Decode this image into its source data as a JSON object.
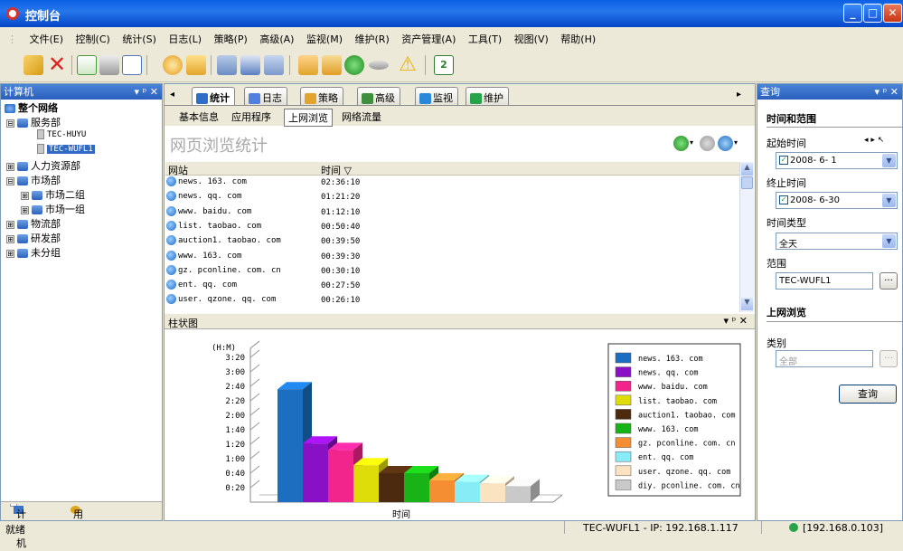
{
  "window": {
    "title": "控制台"
  },
  "menu": [
    "文件(E)",
    "控制(C)",
    "统计(S)",
    "日志(L)",
    "策略(P)",
    "高级(A)",
    "监视(M)",
    "维护(R)",
    "资产管理(A)",
    "工具(T)",
    "视图(V)",
    "帮助(H)"
  ],
  "toolbar_icons": [
    "new-icon",
    "delete-icon",
    "import-icon",
    "print-icon",
    "preview-icon",
    "globe-icon",
    "folder-icon",
    "copy-icon",
    "window-icon",
    "screen-icon",
    "monitor-icon",
    "chart-icon",
    "gem-icon",
    "chip-icon",
    "warning-icon",
    "refresh-icon"
  ],
  "left_panel": {
    "title": "计算机",
    "root": "整个网络",
    "tree": [
      {
        "label": "服务部",
        "expand": "⊟"
      },
      {
        "label": "TEC-HUYU",
        "indent": 2
      },
      {
        "label": "TEC-WUFL1",
        "indent": 2,
        "selected": true
      },
      {
        "label": "人力资源部",
        "expand": "⊞"
      },
      {
        "label": "市场部",
        "expand": "⊟"
      },
      {
        "label": "市场二组",
        "expand": "⊞",
        "indent": 1
      },
      {
        "label": "市场一组",
        "expand": "⊞",
        "indent": 1
      },
      {
        "label": "物流部",
        "expand": "⊞"
      },
      {
        "label": "研发部",
        "expand": "⊞"
      },
      {
        "label": "未分组",
        "expand": "⊞"
      }
    ],
    "tabs": [
      "计算机",
      "用户"
    ]
  },
  "center": {
    "doc_tabs": [
      {
        "label": "统计",
        "color": "#2e6dc8"
      },
      {
        "label": "日志",
        "color": "#4f7fe0"
      },
      {
        "label": "策略",
        "color": "#e2a52b"
      },
      {
        "label": "高级",
        "color": "#3f8e3f"
      },
      {
        "label": "监视",
        "color": "#2a88d8"
      },
      {
        "label": "维护",
        "color": "#27a34a"
      }
    ],
    "sub_tabs": [
      "基本信息",
      "应用程序",
      "上网浏览",
      "网络流量"
    ],
    "active_sub_tab": "上网浏览",
    "title": "网页浏览统计",
    "table": {
      "headers": [
        "网站",
        "时间 ▽"
      ],
      "rows": [
        [
          "news. 163. com",
          "02:36:10"
        ],
        [
          "news. qq. com",
          "01:21:20"
        ],
        [
          "www. baidu. com",
          "01:12:10"
        ],
        [
          "list. taobao. com",
          "00:50:40"
        ],
        [
          "auction1. taobao. com",
          "00:39:50"
        ],
        [
          "www. 163. com",
          "00:39:30"
        ],
        [
          "gz. pconline. com. cn",
          "00:30:10"
        ],
        [
          "ent. qq. com",
          "00:27:50"
        ],
        [
          "user. qzone. qq. com",
          "00:26:10"
        ]
      ]
    },
    "chart_panel_title": "柱状图",
    "chart_panel_controls": "▾ ᵖ ✕"
  },
  "chart_data": {
    "type": "bar",
    "ylabel": "(H:M)",
    "xlabel": "时间",
    "ylim": [
      0,
      200
    ],
    "yticks": [
      "0:20",
      "0:40",
      "1:00",
      "1:20",
      "1:40",
      "2:00",
      "2:20",
      "2:40",
      "3:00",
      "3:20"
    ],
    "categories": [
      "news. 163. com",
      "news. qq. com",
      "www. baidu. com",
      "list. taobao. com",
      "auction1. taobao. com",
      "www. 163. com",
      "gz. pconline. com. cn",
      "ent. qq. com",
      "user. qzone. qq. com",
      "diy. pconline. com. cn"
    ],
    "values": [
      156,
      81,
      72,
      51,
      40,
      40,
      30,
      28,
      26,
      22
    ],
    "colors": [
      "#1b6ec0",
      "#8a10c6",
      "#f2258c",
      "#dedd0a",
      "#4c2a10",
      "#17b317",
      "#f58e33",
      "#88ecf6",
      "#fbe2c0",
      "#c9c9c9"
    ],
    "legend": "right"
  },
  "right_panel": {
    "title": "查询",
    "section_time": "时间和范围",
    "start_label": "起始时间",
    "start_value": "2008- 6- 1",
    "end_label": "终止时间",
    "end_value": "2008- 6-30",
    "time_type_label": "时间类型",
    "time_type_value": "全天",
    "scope_label": "范围",
    "scope_value": "TEC-WUFL1",
    "section_browse": "上网浏览",
    "category_label": "类别",
    "category_value": "全部",
    "query_button": "查询"
  },
  "status": {
    "left": "就绪",
    "center": "TEC-WUFL1 - IP: 192.168.1.117",
    "right": "[192.168.0.103]"
  }
}
